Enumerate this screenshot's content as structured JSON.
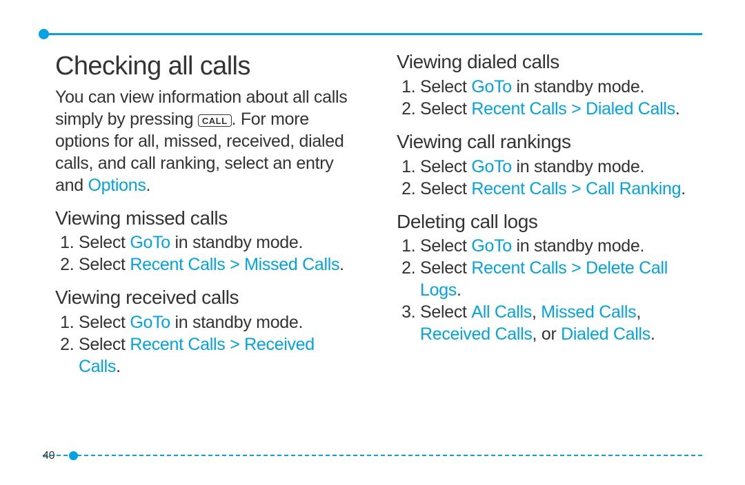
{
  "page_number": "40",
  "colors": {
    "accent": "#00a4e4",
    "text": "#333333"
  },
  "title": "Checking all calls",
  "intro": {
    "t1": "You can view information about all calls simply by pressing ",
    "key_label": "CALL",
    "t2": ". For more options for all, missed, received, dialed calls, and call ranking, select an entry and ",
    "options": "Options",
    "t3": "."
  },
  "sections": {
    "missed": {
      "heading": "Viewing missed calls",
      "s1a": "Select ",
      "s1b": "GoTo",
      "s1c": " in standby mode.",
      "s2a": "Select ",
      "s2b": "Recent Calls",
      "s2c": " > ",
      "s2d": "Missed Calls",
      "s2e": "."
    },
    "received": {
      "heading": "Viewing received calls",
      "s1a": "Select ",
      "s1b": "GoTo",
      "s1c": " in standby mode.",
      "s2a": "Select ",
      "s2b": "Recent Calls",
      "s2c": " > ",
      "s2d": "Received Calls",
      "s2e": "."
    },
    "dialed": {
      "heading": "Viewing dialed calls",
      "s1a": "Select ",
      "s1b": "GoTo",
      "s1c": " in standby mode.",
      "s2a": "Select ",
      "s2b": "Recent Calls",
      "s2c": " > ",
      "s2d": "Dialed Calls",
      "s2e": "."
    },
    "rankings": {
      "heading": "Viewing call rankings",
      "s1a": "Select ",
      "s1b": "GoTo",
      "s1c": " in standby mode.",
      "s2a": "Select ",
      "s2b": "Recent Calls",
      "s2c": " > ",
      "s2d": "Call Ranking",
      "s2e": "."
    },
    "delete": {
      "heading": "Deleting call logs",
      "s1a": "Select ",
      "s1b": "GoTo",
      "s1c": " in standby mode.",
      "s2a": "Select ",
      "s2b": "Recent Calls",
      "s2c": " > ",
      "s2d": "Delete Call Logs",
      "s2e": ".",
      "s3a": "Select ",
      "s3b": "All Calls",
      "s3c": ", ",
      "s3d": "Missed Calls",
      "s3e": ", ",
      "s3f": "Received Calls",
      "s3g": ", or ",
      "s3h": "Dialed Calls",
      "s3i": "."
    }
  }
}
